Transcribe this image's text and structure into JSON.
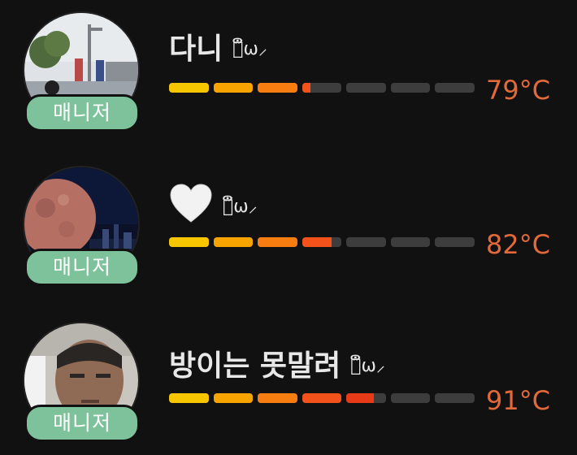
{
  "colors": {
    "background": "#111111",
    "badge": "#7dc29a",
    "temperature_text": "#e2693a",
    "bar_empty": "#3d3d3d",
    "bar_segments": [
      "#f7c600",
      "#f7a300",
      "#f77d10",
      "#f3531a",
      "#e83a16",
      "#d82c1e",
      "#cc241c"
    ]
  },
  "users": [
    {
      "name": "다니",
      "face": "⸜ຶ᷄ω⸝",
      "badge": "매니저",
      "temperature": "79°C",
      "temp_fraction": 0.46,
      "avatar_icon": "street-photo-icon"
    },
    {
      "name": "",
      "emoji": "white-heart-icon",
      "face": "⸜ຶ᷄ω⸝",
      "badge": "매니저",
      "temperature": "82°C",
      "temp_fraction": 0.535,
      "avatar_icon": "red-moon-photo-icon"
    },
    {
      "name": "방이는 못말려",
      "face": "⸜ຶ᷄ω⸝",
      "badge": "매니저",
      "temperature": "91°C",
      "temp_fraction": 0.67,
      "avatar_icon": "person-photo-icon"
    }
  ]
}
